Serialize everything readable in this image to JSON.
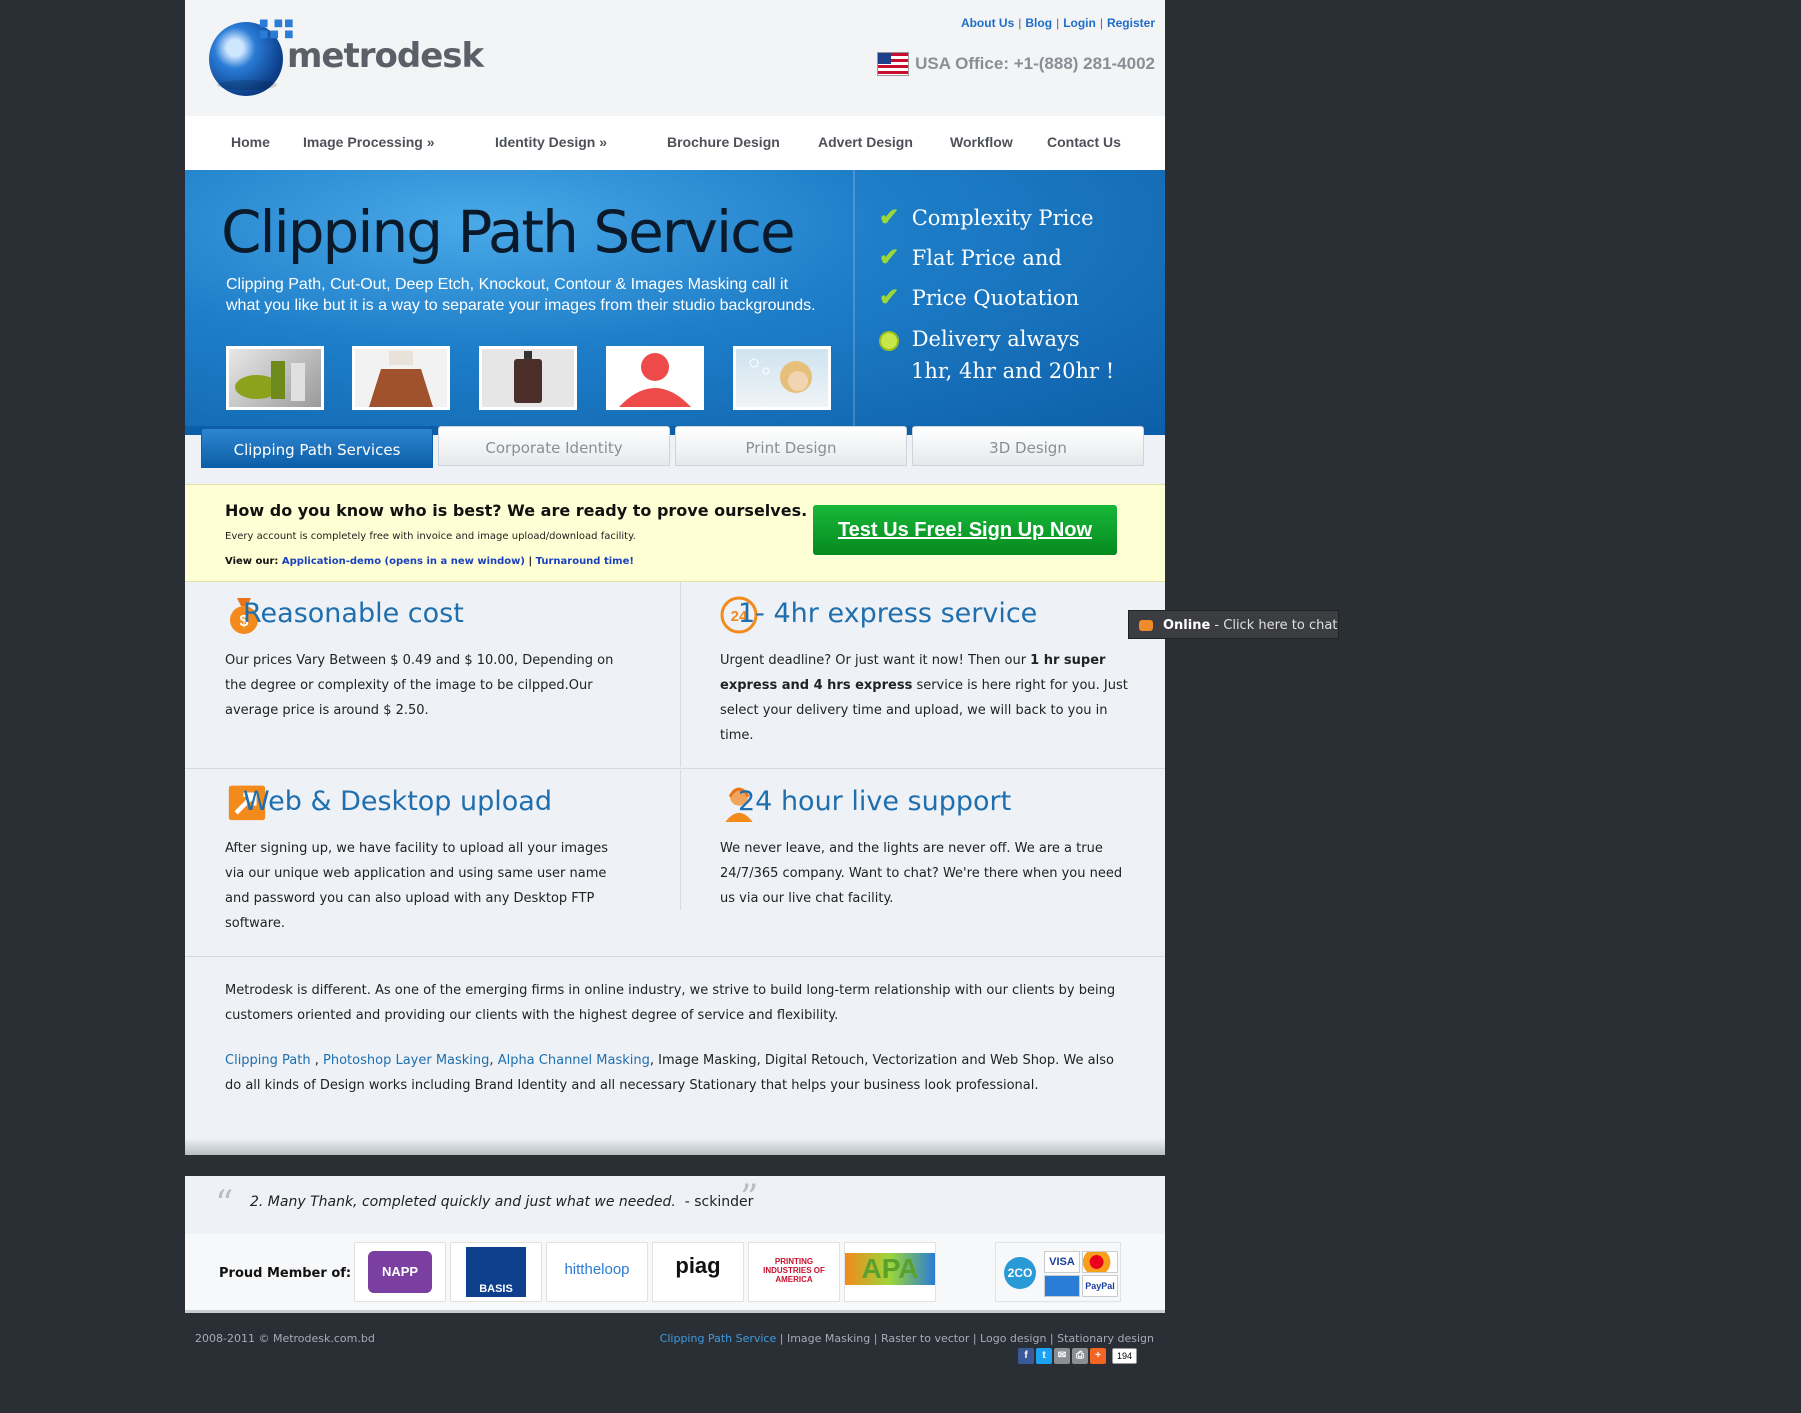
{
  "header": {
    "logo_text": "metrodesk",
    "links": [
      "About Us",
      "Blog",
      "Login",
      "Register"
    ],
    "phone": "USA Office: +1-(888) 281-4002"
  },
  "nav": [
    "Home",
    "Image Processing »",
    "Identity Design »",
    "Brochure Design",
    "Advert Design",
    "Workflow",
    "Contact Us"
  ],
  "hero": {
    "title": "Clipping Path Service",
    "description": "Clipping Path, Cut-Out, Deep Etch, Knockout, Contour & Images Masking call it what you like but it is a way to separate your images from their studio backgrounds.",
    "checks": [
      "Complexity Price",
      "Flat Price and",
      "Price Quotation"
    ],
    "delivery_line1": "Delivery always",
    "delivery_line2": "1hr, 4hr and 20hr !"
  },
  "tabs": [
    "Clipping Path Services",
    "Corporate Identity",
    "Print Design",
    "3D Design"
  ],
  "promo": {
    "heading": "How do you know who is best? We are ready to prove ourselves.",
    "sub": "Every account is completely free with invoice and image upload/download facility.",
    "view_label": "View our:",
    "demo_link": "Application-demo (opens in a new window)",
    "turnaround_link": "Turnaround time!",
    "button": "Test Us Free! Sign Up Now"
  },
  "features": [
    {
      "title": "Reasonable cost",
      "body": "Our prices Vary Between $ 0.49 and $ 10.00, Depending on the degree or complexity of the image to be cilpped.Our average price is around $ 2.50."
    },
    {
      "title": "1- 4hr express service",
      "body_pre": "Urgent deadline? Or just want it now! Then our ",
      "body_bold": "1 hr super express and 4 hrs express",
      "body_post": " service is here right for you. Just select your delivery time and upload, we will back to you in time."
    },
    {
      "title": "Web & Desktop upload",
      "body": "After signing up, we have facility to upload all your images via our unique web application and using same user name and password you can also upload with any Desktop FTP software."
    },
    {
      "title": "24 hour live support",
      "body": "We never leave, and the lights are never off. We are a true 24/7/365 company. Want to chat? We're there when you need us via our live chat facility."
    }
  ],
  "about": {
    "para1": "Metrodesk is different. As one of the emerging firms in online industry, we strive to build long-term relationship with our clients by being customers oriented and providing our clients with the highest degree of service and flexibility.",
    "link1": "Clipping Path",
    "link2": "Photoshop Layer Masking",
    "link3": "Alpha Channel Masking",
    "para2_rest": ", Image Masking, Digital Retouch, Vectorization and Web Shop. We also do all kinds of Design works including Brand Identity and all necessary Stationary that helps your business look professional."
  },
  "testimonial": {
    "quote": "2. Many Thank, completed quickly and just what we needed.",
    "author": "- sckinder"
  },
  "members": {
    "label": "Proud Member of:",
    "badges": [
      "NAPP",
      "BASIS",
      "hittheloop",
      "piag",
      "PRINTING INDUSTRIES OF AMERICA",
      "APA"
    ],
    "payment": [
      "2CO",
      "VISA",
      "PayPal"
    ]
  },
  "footer": {
    "copyright": "2008-2011 © Metrodesk.com.bd",
    "link_highlight": "Clipping Path Service",
    "links_rest": " | Image Masking | Raster to vector | Logo design | Stationary design",
    "share_count": "194"
  },
  "chat": {
    "status": "Online",
    "label": " - Click here to chat"
  },
  "colors": {
    "accent": "#1f6fae",
    "hero_blue": "#1f7fc9",
    "cta_green": "#068a1e",
    "promo_bg": "#ffffd5"
  }
}
